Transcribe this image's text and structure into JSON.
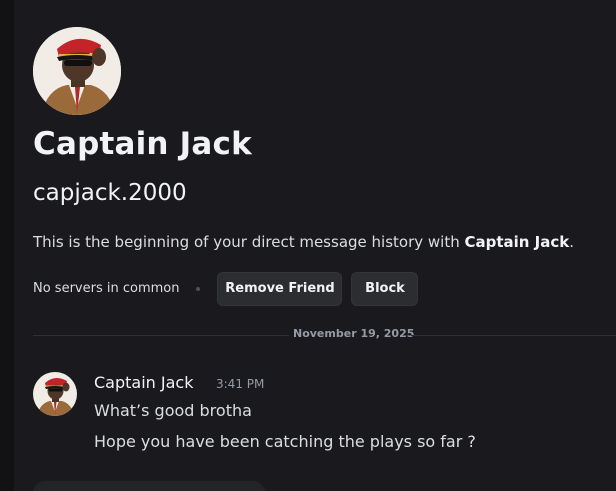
{
  "profile": {
    "display_name": "Captain Jack",
    "username": "capjack.2000",
    "intro_prefix": "This is the beginning of your direct message history with ",
    "intro_name": "Captain Jack",
    "intro_suffix": ".",
    "avatar_icon": "profile-avatar"
  },
  "actions": {
    "servers_text": "No servers in common",
    "remove_friend_label": "Remove Friend",
    "block_label": "Block"
  },
  "divider": {
    "date": "November 19, 2025"
  },
  "messages": [
    {
      "author": "Captain Jack",
      "time": "3:41 PM",
      "lines": [
        "What’s good brotha",
        "Hope you have been catching the plays so far ?"
      ]
    }
  ],
  "colors": {
    "background": "#1a1a1e",
    "text_primary": "#f2f3f5",
    "text_secondary": "#949ba4",
    "button_bg": "#2b2d31"
  }
}
